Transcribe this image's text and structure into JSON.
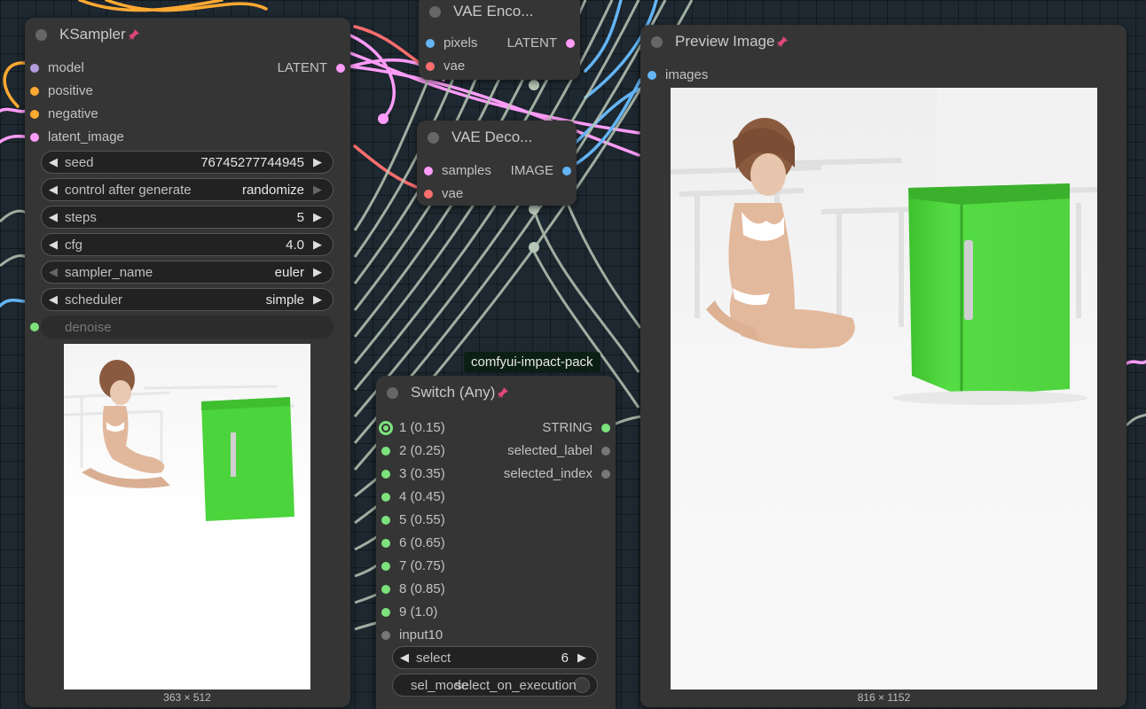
{
  "colors": {
    "canvas": "#1e2830",
    "node_bg": "#353535",
    "model": "#b39ddb",
    "conditioning": "#ffa931",
    "latent": "#ff9cf9",
    "vae": "#ff6e6e",
    "image": "#64b5f6",
    "generic": "#7ce27c",
    "inactive": "#777777",
    "fridge_green": "#4cd43c",
    "pin": "#e0467c"
  },
  "ksampler": {
    "title": "KSampler",
    "inputs": [
      "model",
      "positive",
      "negative",
      "latent_image"
    ],
    "output": "LATENT",
    "widgets": [
      {
        "label": "seed",
        "value": "76745277744945"
      },
      {
        "label": "control after generate",
        "value": "randomize"
      },
      {
        "label": "steps",
        "value": "5"
      },
      {
        "label": "cfg",
        "value": "4.0"
      },
      {
        "label": "sampler_name",
        "value": "euler"
      },
      {
        "label": "scheduler",
        "value": "simple"
      }
    ],
    "denoise_label": "denoise",
    "image_size": "363 × 512"
  },
  "vae_encode": {
    "title": "VAE Enco...",
    "inputs": [
      "pixels",
      "vae"
    ],
    "output": "LATENT"
  },
  "vae_decode": {
    "title": "VAE Deco...",
    "inputs": [
      "samples",
      "vae"
    ],
    "output": "IMAGE"
  },
  "switch": {
    "badge": "comfyui-impact-pack",
    "title": "Switch (Any)",
    "inputs": [
      "1 (0.15)",
      "2 (0.25)",
      "3 (0.35)",
      "4 (0.45)",
      "5 (0.55)",
      "6 (0.65)",
      "7 (0.75)",
      "8 (0.85)",
      "9 (1.0)",
      "input10"
    ],
    "outputs": [
      "STRING",
      "selected_label",
      "selected_index"
    ],
    "select_label": "select",
    "select_value": "6",
    "toggle_label": "sel_mode",
    "toggle_label_overlap": "select_on_execution"
  },
  "preview": {
    "title": "Preview Image",
    "input": "images",
    "image_size": "816 × 1152"
  }
}
